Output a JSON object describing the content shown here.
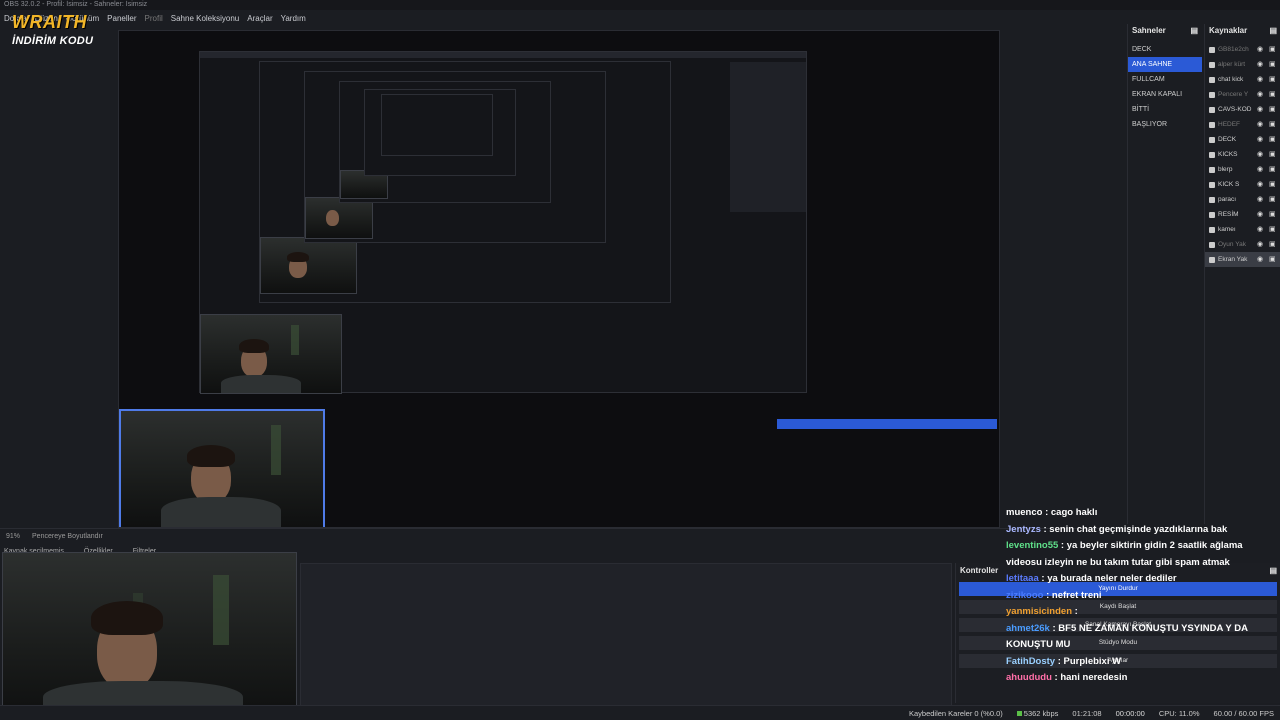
{
  "window": {
    "title": "OBS 32.0.2 - Profil: İsimsiz - Sahneler: İsimsiz"
  },
  "menu": [
    "Dosya",
    "Düzen",
    "Görünüm",
    "Paneller",
    "Profil",
    "Sahne Koleksiyonu",
    "Araçlar",
    "Yardım"
  ],
  "logo": {
    "brand": "WRAITH",
    "sub": "İNDİRİM KODU"
  },
  "preview": {
    "zoom": "91%",
    "fit_label": "Pencereye Boyutlandır"
  },
  "source_bar": {
    "selection": "Kaynak seçilmemiş",
    "properties": "Özellikler",
    "filters": "Filtreler"
  },
  "scenes": {
    "title": "Sahneler",
    "items": [
      {
        "label": "DECK",
        "active": false
      },
      {
        "label": "ANA SAHNE",
        "active": true
      },
      {
        "label": "FULLCAM",
        "active": false
      },
      {
        "label": "EKRAN KAPALI",
        "active": false
      },
      {
        "label": "BİTTİ",
        "active": false
      },
      {
        "label": "BAŞLIYOR",
        "active": false
      }
    ]
  },
  "sources": {
    "title": "Kaynaklar",
    "items": [
      {
        "label": "GB81e2ch",
        "dim": true
      },
      {
        "label": "alper kürt",
        "dim": true
      },
      {
        "label": "chat kick",
        "dim": false
      },
      {
        "label": "Pencere Y",
        "dim": true
      },
      {
        "label": "CAVS-KOD",
        "dim": false
      },
      {
        "label": "HEDEF",
        "dim": true
      },
      {
        "label": "DECK",
        "dim": false
      },
      {
        "label": "KICKS",
        "dim": false
      },
      {
        "label": "blerp",
        "dim": false
      },
      {
        "label": "KICK S",
        "dim": false
      },
      {
        "label": "paracı",
        "dim": false
      },
      {
        "label": "RESİM",
        "dim": false
      },
      {
        "label": "kameı",
        "dim": false
      },
      {
        "label": "Oyun Yak",
        "dim": true
      },
      {
        "label": "Ekran Yak",
        "dim": false
      }
    ]
  },
  "chat": {
    "lines": [
      {
        "user": "muenco",
        "color": "#ffffff",
        "msg": " : cago haklı"
      },
      {
        "user": "Jentyzs",
        "color": "#aab8ff",
        "msg": " : senin chat geçmişinde yazdıklarına bak"
      },
      {
        "user": "leventino55",
        "color": "#5fe08a",
        "msg": " : ya beyler siktirin gidin 2 saatlik ağlama videosu izleyin ne bu takım tutar gibi spam atmak"
      },
      {
        "user": "letitaaa",
        "color": "#5b7cff",
        "msg": " : ya burada neler neler dediler"
      },
      {
        "user": "zizikooo",
        "color": "#4a7cff",
        "msg": " : nefret treni"
      },
      {
        "user": "yanmisicinden",
        "color": "#f0a030",
        "msg": " : "
      },
      {
        "user": "ahmet26k",
        "color": "#4a9cff",
        "msg": " : BF5 NE ZAMAN KONUŞTU YSYINDA Y DA KONUŞTU MU"
      },
      {
        "user": "FatihDosty",
        "color": "#9ad0ff",
        "msg": " : Purplebixi W"
      },
      {
        "user": "ahuududu",
        "color": "#ff6fa8",
        "msg": " : hani neredesin"
      }
    ]
  },
  "controls": {
    "title": "Kontroller",
    "buttons": [
      "Yayını Durdur",
      "Kaydı Başlat",
      "Sanal Kamerayı Başlat",
      "Stüdyo Modu",
      "Ayarlar"
    ]
  },
  "status": {
    "dropped": "Kaybedilen Kareler 0 (%0.0)",
    "bitrate": "5362 kbps",
    "stream_time": "01:21:08",
    "rec_time": "00:00:00",
    "cpu": "CPU: 11.0%",
    "fps": "60.00 / 60.00 FPS"
  }
}
